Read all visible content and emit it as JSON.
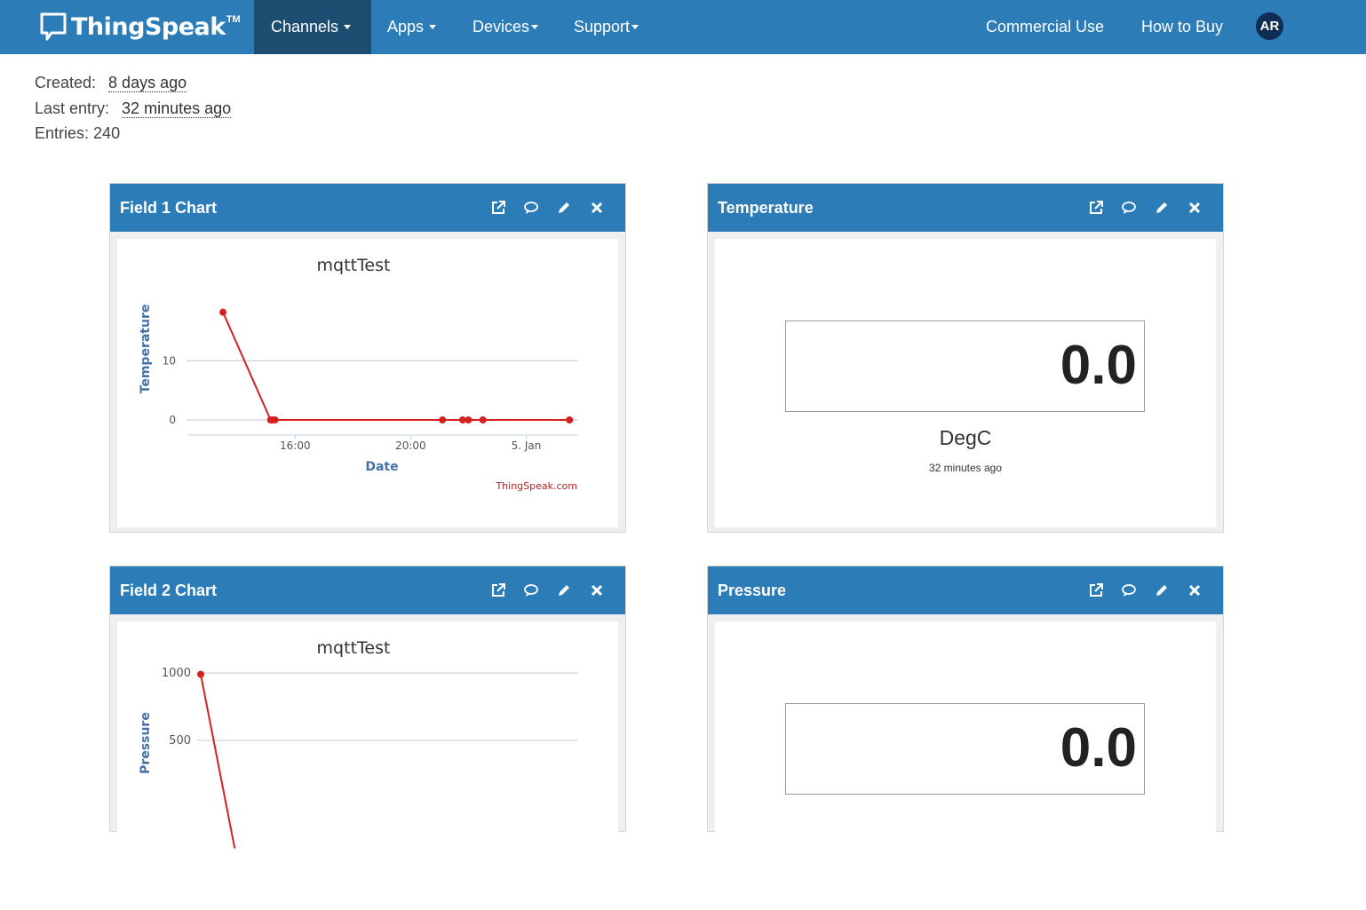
{
  "navbar": {
    "brand": "ThingSpeak",
    "brand_tm": "TM",
    "channels": "Channels",
    "apps": "Apps",
    "devices": "Devices",
    "support": "Support",
    "commercial_use": "Commercial Use",
    "how_to_buy": "How to Buy",
    "avatar_initials": "AR",
    "colors": {
      "bar": "#2c7cb8",
      "active": "#1d4e72",
      "avatar": "#0f2d52"
    }
  },
  "channel_info": {
    "created_label": "Created:",
    "created_value": "8 days ago",
    "last_entry_label": "Last entry:",
    "last_entry_value": "32 minutes ago",
    "entries_label": "Entries:",
    "entries_value": "240"
  },
  "widgets": [
    {
      "title": "Field 1 Chart",
      "icons": [
        "external-link-icon",
        "comment-icon",
        "pencil-icon",
        "close-icon"
      ]
    },
    {
      "title": "Temperature",
      "icons": [
        "external-link-icon",
        "comment-icon",
        "pencil-icon",
        "close-icon"
      ]
    },
    {
      "title": "Field 2 Chart",
      "icons": [
        "external-link-icon",
        "comment-icon",
        "pencil-icon",
        "close-icon"
      ]
    },
    {
      "title": "Pressure",
      "icons": [
        "external-link-icon",
        "comment-icon",
        "pencil-icon",
        "close-icon"
      ]
    }
  ],
  "numeric_displays": {
    "temperature": {
      "value": "0.0",
      "unit": "DegC",
      "updated": "32 minutes ago"
    },
    "pressure": {
      "value": "0.0"
    }
  },
  "chart_data": [
    {
      "type": "line",
      "title": "mqttTest",
      "xlabel": "Date",
      "ylabel": "Temperature",
      "x_ticks": [
        "16:00",
        "20:00",
        "5. Jan"
      ],
      "y_ticks": [
        "0",
        "10"
      ],
      "ylim": [
        -1.2,
        21
      ],
      "xlim_hours": [
        12.3,
        25.8
      ],
      "credit": "ThingSpeak.com",
      "series_color": "#d62020",
      "series": [
        {
          "x_hours": [
            13.5,
            15.15,
            15.22,
            15.3,
            21.1,
            21.8,
            22.0,
            22.5,
            25.5
          ],
          "values": [
            18.2,
            0,
            0,
            0,
            0,
            0,
            0,
            0,
            0
          ]
        }
      ]
    },
    {
      "type": "line",
      "title": "mqttTest",
      "xlabel": "",
      "ylabel": "Pressure",
      "y_ticks": [
        "1000",
        "500"
      ],
      "ylim": [
        -500,
        1000
      ],
      "series_color": "#d62020",
      "series": [
        {
          "x_fraction": [
            0.0,
            0.09
          ],
          "values": [
            990,
            -300
          ]
        }
      ]
    }
  ]
}
